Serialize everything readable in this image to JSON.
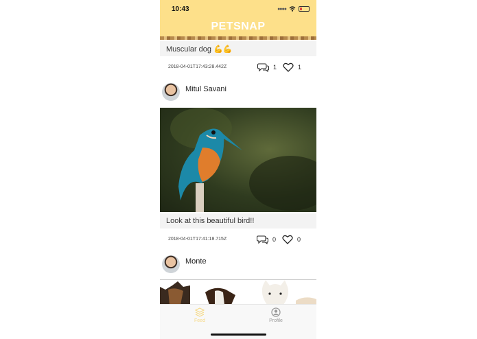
{
  "status": {
    "time": "10:43"
  },
  "app": {
    "title": "PETSNAP"
  },
  "posts": [
    {
      "caption": "Muscular dog 💪💪",
      "timestamp": "2018-04-01T17:43:28.442Z",
      "comments": "1",
      "likes": "1"
    },
    {
      "author": "Mitul Savani",
      "caption": "Look at this beautiful bird!!",
      "timestamp": "2018-04-01T17:41:18.715Z",
      "comments": "0",
      "likes": "0"
    },
    {
      "author": "Monte"
    }
  ],
  "tabs": [
    {
      "label": "Feed",
      "icon": "layers-icon",
      "active": true,
      "color": "#f6d983"
    },
    {
      "label": "Profile",
      "icon": "profile-icon",
      "active": false,
      "color": "#9a9a9a"
    }
  ],
  "colors": {
    "header": "#fde08a",
    "caption_bg": "#f3f3f3"
  }
}
